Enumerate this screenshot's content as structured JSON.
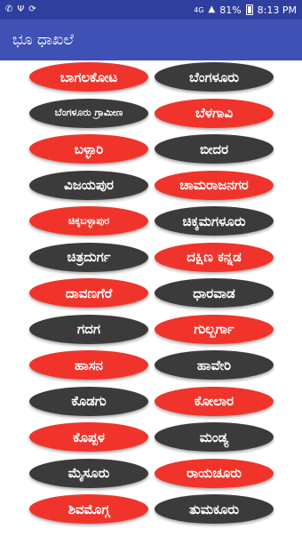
{
  "status_bar": {
    "signal": "4G",
    "battery": "81%",
    "time": "8:13 PM",
    "left_icons": [
      "whatsapp-icon",
      "usb-icon",
      "sync-icon"
    ]
  },
  "app_bar": {
    "title": "ಭೂ ಧಾಖಲೆ"
  },
  "colors": {
    "status_bar": "#2f3f9e",
    "app_bar": "#3f51b5",
    "red_button": "#f0342b",
    "dark_button": "#3b3b3b"
  },
  "districts": [
    {
      "label": "ಬಾಗಲಕೋಟ",
      "color": "red"
    },
    {
      "label": "ಬೆಂಗಳೂರು",
      "color": "dark"
    },
    {
      "label": "ಬೆಂಗಳೂರು ಗ್ರಾಮೀಣ",
      "color": "dark"
    },
    {
      "label": "ಬೆಳಗಾವಿ",
      "color": "red"
    },
    {
      "label": "ಬಳ್ಳಾರಿ",
      "color": "red"
    },
    {
      "label": "ಬೀದರ",
      "color": "dark"
    },
    {
      "label": "ವಿಜಯಪುರ",
      "color": "dark"
    },
    {
      "label": "ಚಾಮರಾಜನಗರ",
      "color": "red"
    },
    {
      "label": "ಚಿಕ್ಕಬಳ್ಳಾಪುರ",
      "color": "red"
    },
    {
      "label": "ಚಿಕ್ಕಮಗಳೂರು",
      "color": "dark"
    },
    {
      "label": "ಚಿತ್ರದುರ್ಗ",
      "color": "dark"
    },
    {
      "label": "ದಕ್ಷಿಣ ಕನ್ನಡ",
      "color": "red"
    },
    {
      "label": "ದಾವಣಗೆರೆ",
      "color": "red"
    },
    {
      "label": "ಧಾರವಾಡ",
      "color": "dark"
    },
    {
      "label": "ಗದಗ",
      "color": "dark"
    },
    {
      "label": "ಗುಲ್ಬರ್ಗಾ",
      "color": "red"
    },
    {
      "label": "ಹಾಸನ",
      "color": "red"
    },
    {
      "label": "ಹಾವೇರಿ",
      "color": "dark"
    },
    {
      "label": "ಕೊಡಗು",
      "color": "dark"
    },
    {
      "label": "ಕೋಲಾರ",
      "color": "red"
    },
    {
      "label": "ಕೊಪ್ಪಳ",
      "color": "red"
    },
    {
      "label": "ಮಂಡ್ಯ",
      "color": "dark"
    },
    {
      "label": "ಮೈಸೂರು",
      "color": "dark"
    },
    {
      "label": "ರಾಯಚೂರು",
      "color": "red"
    },
    {
      "label": "ಶಿವಮೊಗ್ಗ",
      "color": "red"
    },
    {
      "label": "ತುಮಕೂರು",
      "color": "dark"
    }
  ]
}
